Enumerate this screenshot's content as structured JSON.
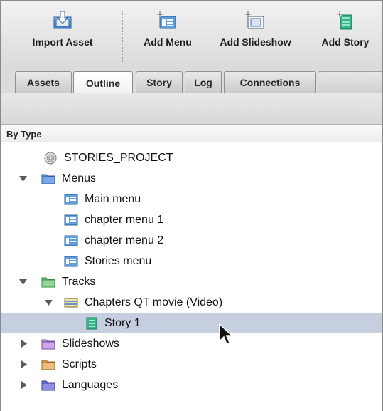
{
  "toolbar": {
    "buttons": [
      {
        "label": "Import Asset",
        "icon": "import-asset-icon"
      },
      {
        "label": "Add Menu",
        "icon": "add-menu-icon"
      },
      {
        "label": "Add Slideshow",
        "icon": "add-slideshow-icon"
      },
      {
        "label": "Add Story",
        "icon": "add-story-icon"
      }
    ]
  },
  "tabs": [
    {
      "label": "Assets",
      "active": false
    },
    {
      "label": "Outline",
      "active": true
    },
    {
      "label": "Story",
      "active": false
    },
    {
      "label": "Log",
      "active": false
    },
    {
      "label": "Connections",
      "active": false
    }
  ],
  "outline": {
    "header": "By Type",
    "rows": [
      {
        "label": "STORIES_PROJECT",
        "icon": "disc-icon",
        "expanded": null,
        "level": 1
      },
      {
        "label": "Menus",
        "icon": "folder-icon",
        "expanded": true,
        "level": 0
      },
      {
        "label": "Main menu",
        "icon": "menu-icon",
        "expanded": null,
        "level": 1
      },
      {
        "label": "chapter menu 1",
        "icon": "menu-icon",
        "expanded": null,
        "level": 1
      },
      {
        "label": "chapter menu 2",
        "icon": "menu-icon",
        "expanded": null,
        "level": 1
      },
      {
        "label": "Stories menu",
        "icon": "menu-icon",
        "expanded": null,
        "level": 1
      },
      {
        "label": "Tracks",
        "icon": "folder-icon",
        "expanded": true,
        "level": 0
      },
      {
        "label": "Chapters QT movie (Video)",
        "icon": "track-icon",
        "expanded": true,
        "level": 1
      },
      {
        "label": "Story 1",
        "icon": "story-icon",
        "expanded": null,
        "level": 2,
        "selected": true
      },
      {
        "label": "Slideshows",
        "icon": "folder-icon",
        "expanded": false,
        "level": 0
      },
      {
        "label": "Scripts",
        "icon": "folder-icon",
        "expanded": false,
        "level": 0
      },
      {
        "label": "Languages",
        "icon": "folder-icon",
        "expanded": false,
        "level": 0
      }
    ]
  },
  "colors": {
    "folder_menus": "#5b8fd8",
    "folder_tracks": "#6fc27a",
    "folder_slideshows": "#b88ad6",
    "folder_scripts": "#d9a05a",
    "folder_languages": "#6f73d0",
    "selection": "#c5cfe0"
  }
}
